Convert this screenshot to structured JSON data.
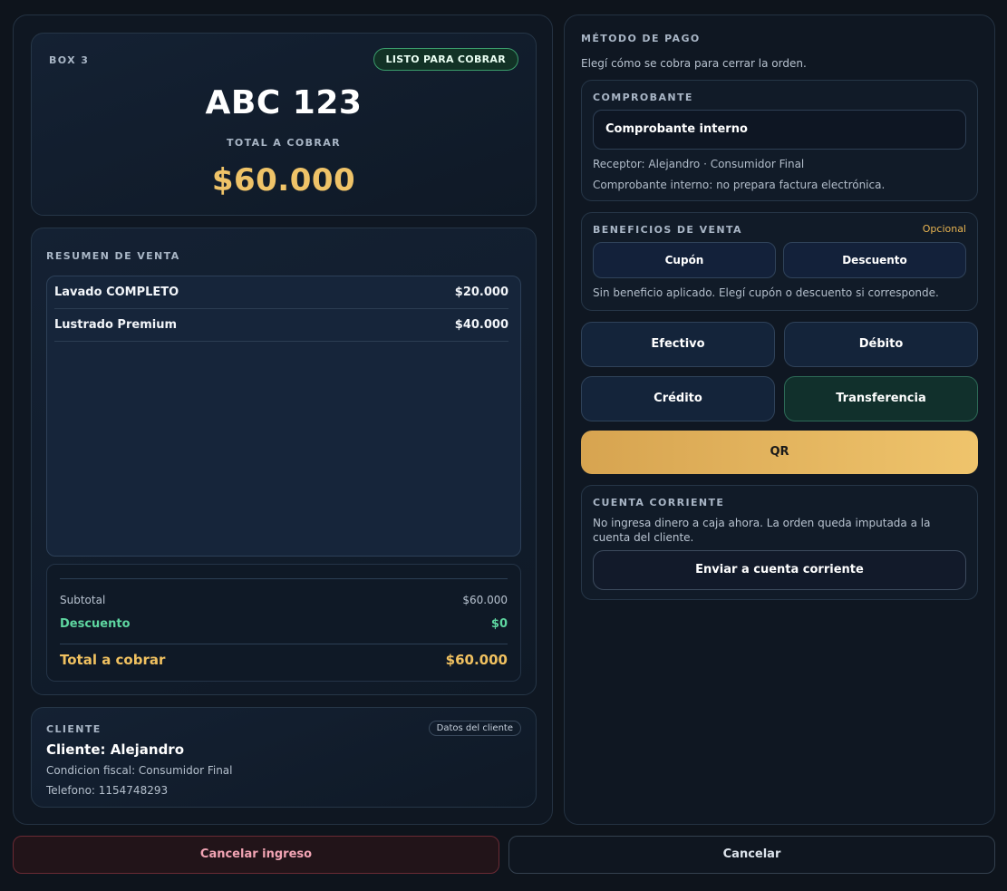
{
  "hero": {
    "box_label": "BOX 3",
    "status_badge": "LISTO PARA COBRAR",
    "plate": "ABC 123",
    "total_label": "TOTAL A COBRAR",
    "total_amount": "$60.000"
  },
  "summary": {
    "title": "RESUMEN DE VENTA",
    "items": [
      {
        "name": "Lavado COMPLETO",
        "price": "$20.000"
      },
      {
        "name": "Lustrado Premium",
        "price": "$40.000"
      }
    ],
    "subtotal_label": "Subtotal",
    "subtotal_value": "$60.000",
    "discount_label": "Descuento",
    "discount_value": "$0",
    "total_label": "Total a cobrar",
    "total_value": "$60.000"
  },
  "client": {
    "title": "CLIENTE",
    "details_badge": "Datos del cliente",
    "name": "Cliente: Alejandro",
    "tax_condition": "Condicion fiscal: Consumidor Final",
    "phone": "Telefono: 1154748293"
  },
  "payment": {
    "title": "MÉTODO DE PAGO",
    "subtitle": "Elegí cómo se cobra para cerrar la orden.",
    "voucher": {
      "title": "COMPROBANTE",
      "selected": "Comprobante interno",
      "receiver": "Receptor: Alejandro · Consumidor Final",
      "note": "Comprobante interno: no prepara factura electrónica."
    },
    "benefits": {
      "title": "BENEFICIOS DE VENTA",
      "optional": "Opcional",
      "coupon_label": "Cupón",
      "discount_label": "Descuento",
      "note": "Sin beneficio aplicado. Elegí cupón o descuento si corresponde."
    },
    "methods": {
      "cash": "Efectivo",
      "debit": "Débito",
      "credit": "Crédito",
      "transfer": "Transferencia",
      "qr": "QR"
    },
    "selected_method": "Transferencia",
    "current_account": {
      "title": "CUENTA CORRIENTE",
      "note": "No ingresa dinero a caja ahora. La orden queda imputada a la cuenta del cliente.",
      "button": "Enviar a cuenta corriente"
    }
  },
  "footer": {
    "cancel_entry": "Cancelar ingreso",
    "cancel": "Cancelar"
  },
  "colors": {
    "background": "#0e141c",
    "accent_gold": "#efc368",
    "success_green": "#5ed6a0",
    "danger_pink": "#f2a4b4"
  }
}
